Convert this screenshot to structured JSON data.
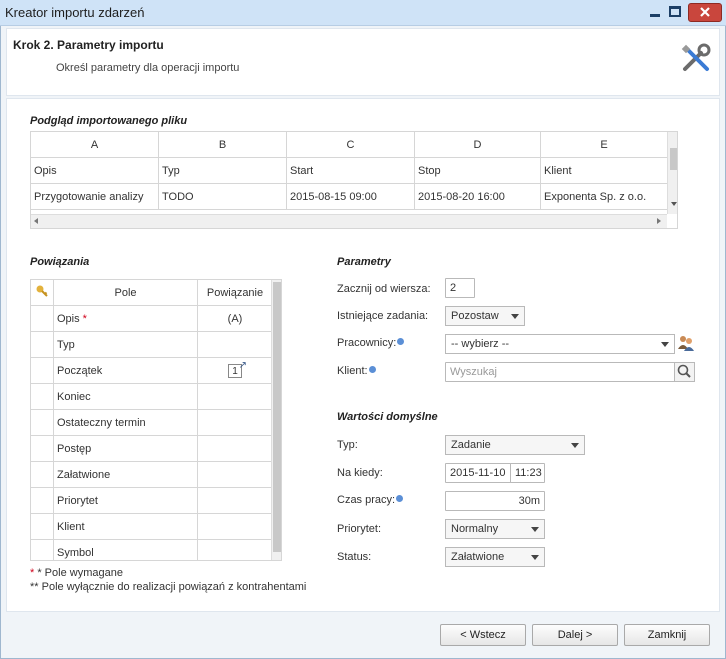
{
  "window": {
    "title": "Kreator importu zdarzeń"
  },
  "header": {
    "step": "Krok 2. Parametry importu",
    "description": "Określ parametry dla operacji importu"
  },
  "preview": {
    "title": "Podgląd importowanego pliku",
    "columns": [
      "A",
      "B",
      "C",
      "D",
      "E"
    ],
    "rows": [
      [
        "Opis",
        "Typ",
        "Start",
        "Stop",
        "Klient"
      ],
      [
        "Przygotowanie analizy",
        "TODO",
        "2015-08-15 09:00",
        "2015-08-20 16:00",
        "Exponenta Sp. z o.o."
      ]
    ]
  },
  "mappings": {
    "title": "Powiązania",
    "col_field": "Pole",
    "col_binding": "Powiązanie",
    "rows": [
      {
        "field": "Opis",
        "required": "*",
        "binding": "(A)"
      },
      {
        "field": "Typ",
        "required": "",
        "binding": ""
      },
      {
        "field": "Początek",
        "required": "",
        "binding": "1"
      },
      {
        "field": "Koniec",
        "required": "",
        "binding": ""
      },
      {
        "field": "Ostateczny termin",
        "required": "",
        "binding": ""
      },
      {
        "field": "Postęp",
        "required": "",
        "binding": ""
      },
      {
        "field": "Załatwione",
        "required": "",
        "binding": ""
      },
      {
        "field": "Priorytet",
        "required": "",
        "binding": ""
      },
      {
        "field": "Klient",
        "required": "",
        "binding": ""
      },
      {
        "field": "Symbol",
        "required": "",
        "binding": ""
      }
    ],
    "note_required": "* Pole wymagane",
    "note_contractors": "** Pole wyłącznie do realizacji powiązań z kontrahentami"
  },
  "params": {
    "title": "Parametry",
    "start_row_label": "Zacznij od wiersza:",
    "start_row_value": "2",
    "existing_label": "Istniejące zadania:",
    "existing_value": "Pozostaw",
    "employees_label": "Pracownicy:",
    "employees_value": "-- wybierz --",
    "client_label": "Klient:",
    "client_placeholder": "Wyszukaj"
  },
  "defaults": {
    "title": "Wartości domyślne",
    "type_label": "Typ:",
    "type_value": "Zadanie",
    "due_label": "Na kiedy:",
    "due_date": "2015-11-10",
    "due_time": "11:23",
    "worktime_label": "Czas pracy:",
    "worktime_value": "30m",
    "priority_label": "Priorytet:",
    "priority_value": "Normalny",
    "status_label": "Status:",
    "status_value": "Załatwione"
  },
  "footer": {
    "back": "< Wstecz",
    "next": "Dalej >",
    "close": "Zamknij"
  },
  "colors": {
    "titlebar": "#cfe3f7",
    "close_btn": "#c9463d",
    "info": "#5b8fd6",
    "required": "#d0021b"
  }
}
